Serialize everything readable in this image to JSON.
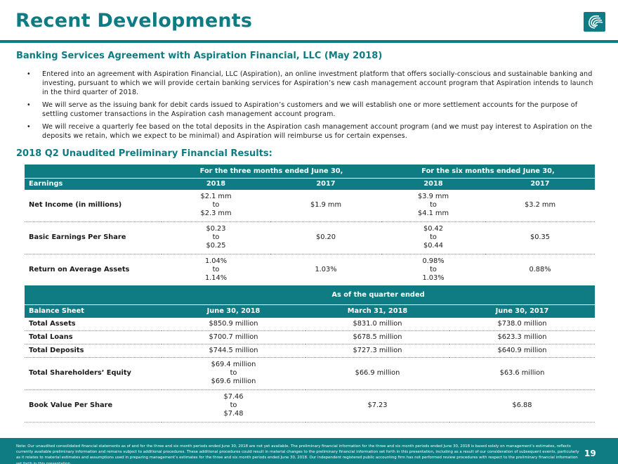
{
  "title": "Recent Developments",
  "logo_icon": "aspiration-wave-logo-icon",
  "section1": {
    "heading": "Banking Services Agreement with Aspiration Financial, LLC (May 2018)",
    "bullets": [
      "Entered into an agreement with Aspiration Financial, LLC (Aspiration), an online investment platform that offers socially-conscious and sustainable banking and investing, pursuant to which we will provide certain banking services for Aspiration’s new cash management account program that Aspiration intends to launch in the third quarter of 2018.",
      "We will serve as the issuing bank for debit cards issued to Aspiration’s customers and we will establish one or more settlement accounts for the purpose of settling customer transactions in the Aspiration cash management account program.",
      "We will receive a quarterly fee based on the total deposits in the Aspiration cash management account program (and we must pay interest to Aspiration on the deposits we retain, which we expect to be minimal) and Aspiration will reimburse us for certain expenses."
    ]
  },
  "section2": {
    "heading": "2018 Q2 Unaudited Preliminary Financial Results:"
  },
  "earnings_table": {
    "group_headers": [
      "For the three months ended June 30,",
      "For the six months ended June 30,"
    ],
    "label_header": "Earnings",
    "columns": [
      "2018",
      "2017",
      "2018",
      "2017"
    ],
    "rows": [
      {
        "label": "Net Income (in millions)",
        "c1": [
          "$2.1 mm",
          "to",
          "$2.3 mm"
        ],
        "c2": "$1.9 mm",
        "c3": [
          "$3.9 mm",
          "to",
          "$4.1 mm"
        ],
        "c4": "$3.2 mm"
      },
      {
        "label": "Basic Earnings Per Share",
        "c1": [
          "$0.23",
          "to",
          "$0.25"
        ],
        "c2": "$0.20",
        "c3": [
          "$0.42",
          "to",
          "$0.44"
        ],
        "c4": "$0.35"
      },
      {
        "label": "Return on Average Assets",
        "c1": [
          "1.04%",
          "to",
          "1.14%"
        ],
        "c2": "1.03%",
        "c3": [
          "0.98%",
          "to",
          "1.03%"
        ],
        "c4": "0.88%"
      }
    ]
  },
  "balance_table": {
    "group_header": "As of the quarter ended",
    "label_header": "Balance Sheet",
    "columns": [
      "June 30, 2018",
      "March 31, 2018",
      "June 30, 2017"
    ],
    "rows": [
      {
        "label": "Total Assets",
        "c1": "$850.9 million",
        "c2": "$831.0 million",
        "c3": "$738.0 million"
      },
      {
        "label": "Total Loans",
        "c1": "$700.7 million",
        "c2": "$678.5 million",
        "c3": "$623.3 million"
      },
      {
        "label": "Total Deposits",
        "c1": "$744.5 million",
        "c2": "$727.3 million",
        "c3": "$640.9 million"
      },
      {
        "label": "Total Shareholders’ Equity",
        "c1": [
          "$69.4 million",
          "to",
          "$69.6 million"
        ],
        "c2": "$66.9 million",
        "c3": "$63.6 million"
      },
      {
        "label": "Book Value Per Share",
        "c1": [
          "$7.46",
          "to",
          "$7.48"
        ],
        "c2": "$7.23",
        "c3": "$6.88"
      }
    ]
  },
  "footer": {
    "note": "Note: Our unaudited consolidated financial statements as of and for the three and six month periods ended June 30, 2018 are not yet available. The preliminary financial information for the three and six month periods ended June 30, 2018 is based solely on management’s estimates, reflects currently available preliminary information and remains subject to additional procedures. These additional procedures could result in material changes to the preliminary financial information set forth in this presentation, including as a result of our consideration of subsequent events, particularly as it relates to material estimates and assumptions used in preparing management’s estimates for the three and six month periods ended June 30, 2018. Our independent registered public accounting firm has not performed review procedures with respect to the preliminary financial information set forth in this presentation.",
    "page_number": "19"
  },
  "colors": {
    "brand_teal": "#0f7b82"
  }
}
